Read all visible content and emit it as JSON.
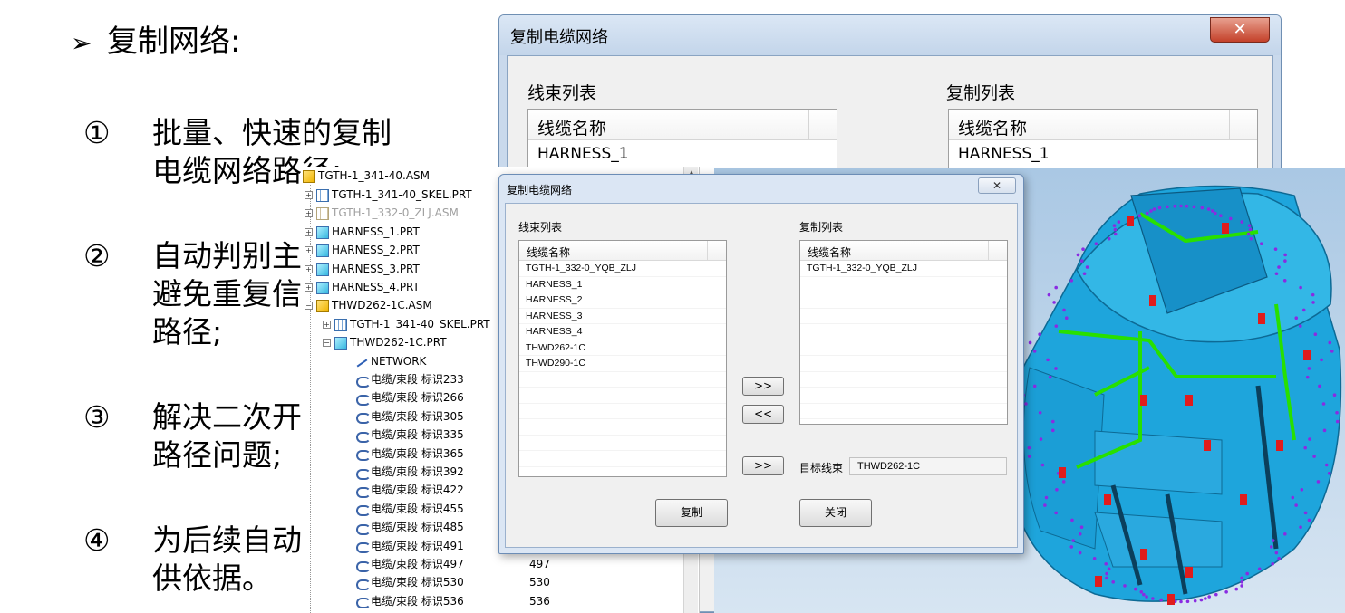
{
  "slide": {
    "bullet_icon": "arrow-bullet-icon",
    "title": "复制网络:",
    "points": [
      {
        "num": "①",
        "line1": "批量、快速的复制",
        "line2": "电缆网络路径;"
      },
      {
        "num": "②",
        "line1": "自动判别主",
        "line2": "避免重复信",
        "line3": "路径;"
      },
      {
        "num": "③",
        "line1": "解决二次开",
        "line2": "路径问题;"
      },
      {
        "num": "④",
        "line1": "为后续自动",
        "line2": "供依据。"
      }
    ]
  },
  "back_dialog": {
    "title": "复制电缆网络",
    "close": "✕",
    "left_label": "线束列表",
    "right_label": "复制列表",
    "column": "线缆名称",
    "left_rows": [
      "HARNESS_1"
    ],
    "right_rows": [
      "HARNESS_1"
    ]
  },
  "tree": {
    "nodes": [
      {
        "label": "TGTH-1_341-40.ASM"
      },
      {
        "label": "TGTH-1_341-40_SKEL.PRT"
      },
      {
        "label": "TGTH-1_332-0_ZLJ.ASM"
      },
      {
        "label": "HARNESS_1.PRT"
      },
      {
        "label": "HARNESS_2.PRT"
      },
      {
        "label": "HARNESS_3.PRT"
      },
      {
        "label": "HARNESS_4.PRT"
      },
      {
        "label": "THWD262-1C.ASM"
      },
      {
        "label": "TGTH-1_341-40_SKEL.PRT"
      },
      {
        "label": "THWD262-1C.PRT"
      },
      {
        "label": "NETWORK"
      }
    ],
    "segments": [
      {
        "label": "电缆/束段 标识233",
        "num": ""
      },
      {
        "label": "电缆/束段 标识266",
        "num": ""
      },
      {
        "label": "电缆/束段 标识305",
        "num": ""
      },
      {
        "label": "电缆/束段 标识335",
        "num": ""
      },
      {
        "label": "电缆/束段 标识365",
        "num": ""
      },
      {
        "label": "电缆/束段 标识392",
        "num": ""
      },
      {
        "label": "电缆/束段 标识422",
        "num": ""
      },
      {
        "label": "电缆/束段 标识455",
        "num": ""
      },
      {
        "label": "电缆/束段 标识485",
        "num": ""
      },
      {
        "label": "电缆/束段 标识491",
        "num": ""
      },
      {
        "label": "电缆/束段 标识497",
        "num": "497"
      },
      {
        "label": "电缆/束段 标识530",
        "num": "530"
      },
      {
        "label": "电缆/束段 标识536",
        "num": "536"
      }
    ]
  },
  "dialog": {
    "title": "复制电缆网络",
    "close": "✕",
    "left_label": "线束列表",
    "right_label": "复制列表",
    "column": "线缆名称",
    "left_rows": [
      "TGTH-1_332-0_YQB_ZLJ",
      "HARNESS_1",
      "HARNESS_2",
      "HARNESS_3",
      "HARNESS_4",
      "THWD262-1C",
      "THWD290-1C"
    ],
    "right_rows": [
      "TGTH-1_332-0_YQB_ZLJ"
    ],
    "add_btn": ">>",
    "remove_btn": "<<",
    "target_btn": ">>",
    "target_label": "目标线束",
    "target_value": "THWD262-1C",
    "copy_btn": "复制",
    "close_btn": "关闭"
  },
  "colors": {
    "model_body": "#1aa3dc",
    "model_wire": "#22e000",
    "model_connector": "#e01c1c",
    "model_points": "#8a2be2"
  }
}
